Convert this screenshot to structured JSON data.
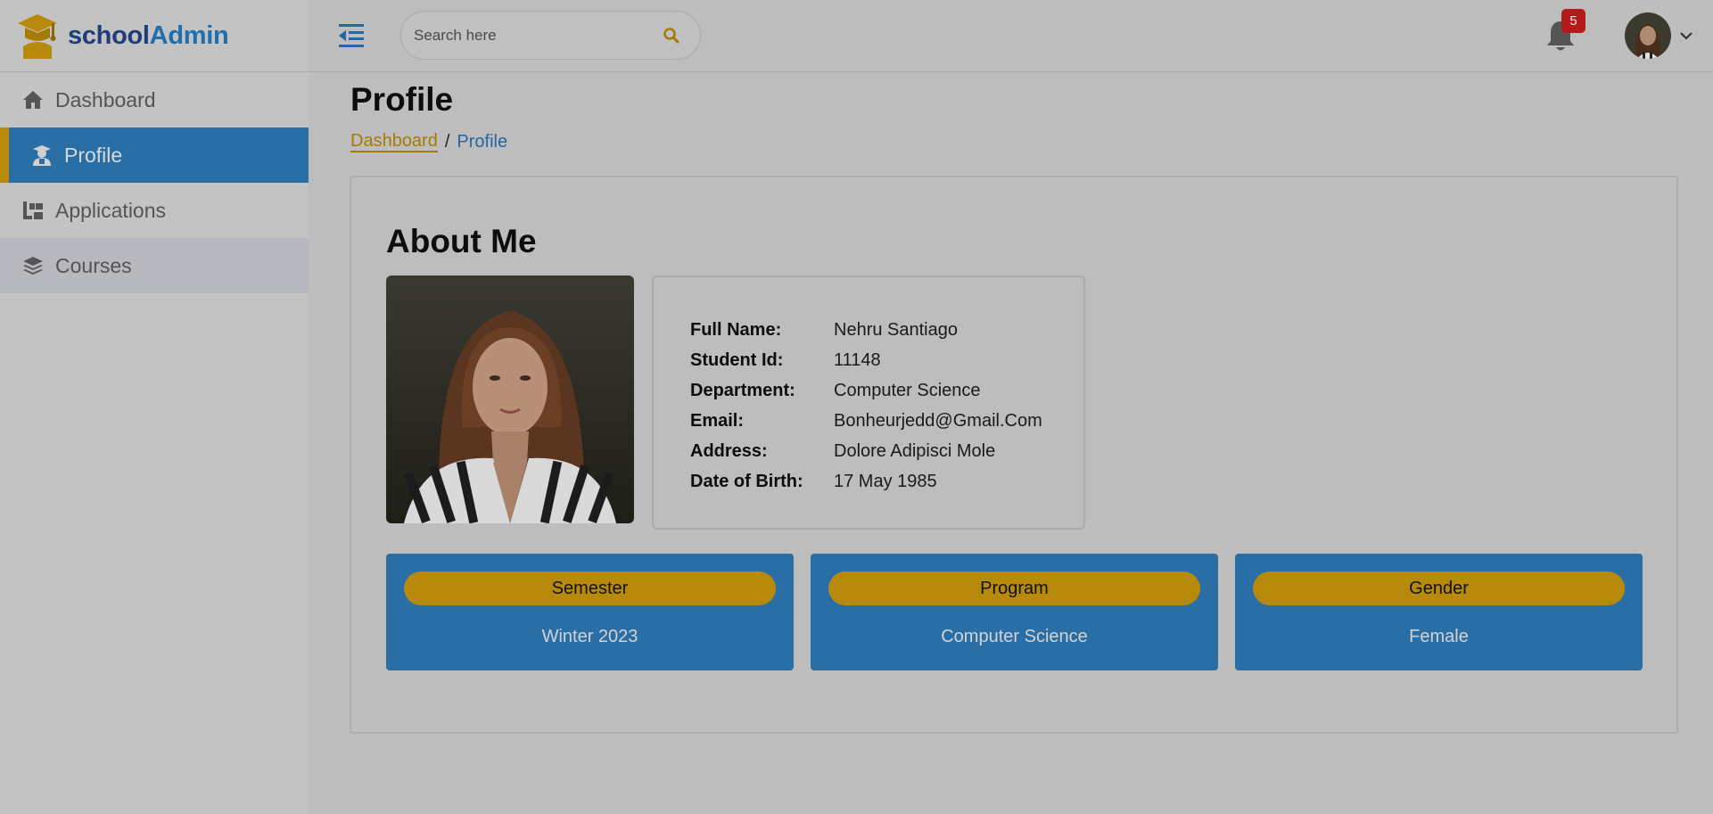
{
  "brand": {
    "part1": "school",
    "part2": "Admin"
  },
  "sidebar": {
    "items": [
      {
        "label": "Dashboard",
        "icon": "home-icon"
      },
      {
        "label": "Profile",
        "icon": "student-icon"
      },
      {
        "label": "Applications",
        "icon": "applications-icon"
      },
      {
        "label": "Courses",
        "icon": "layers-icon"
      }
    ]
  },
  "topbar": {
    "search_placeholder": "Search here",
    "notification_count": "5"
  },
  "page": {
    "title": "Profile",
    "breadcrumb": {
      "link": "Dashboard",
      "separator": "/",
      "current": "Profile"
    }
  },
  "about": {
    "title": "About Me",
    "fields": [
      {
        "label": "Full Name:",
        "value": "Nehru Santiago"
      },
      {
        "label": "Student Id:",
        "value": "11148"
      },
      {
        "label": "Department:",
        "value": "Computer Science"
      },
      {
        "label": "Email:",
        "value": "Bonheurjedd@Gmail.Com"
      },
      {
        "label": "Address:",
        "value": "Dolore Adipisci Mole"
      },
      {
        "label": "Date of Birth:",
        "value": "17 May 1985"
      }
    ]
  },
  "stats": [
    {
      "label": "Semester",
      "value": "Winter 2023"
    },
    {
      "label": "Program",
      "value": "Computer Science"
    },
    {
      "label": "Gender",
      "value": "Female"
    }
  ],
  "colors": {
    "primary": "#2a6ea6",
    "accent": "#b78a0b",
    "badge": "#b31a1a"
  }
}
